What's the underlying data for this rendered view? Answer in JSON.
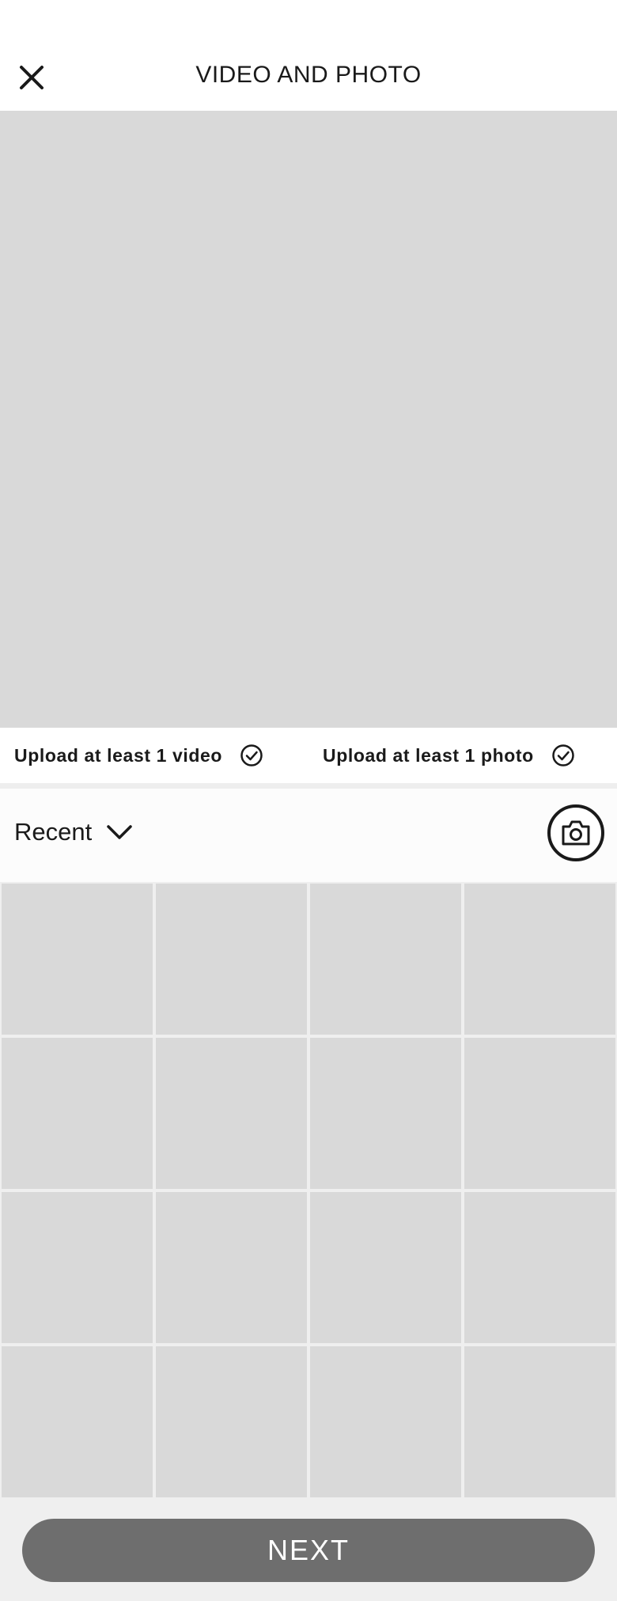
{
  "header": {
    "title": "VIDEO AND PHOTO",
    "close_icon": "close-icon"
  },
  "requirements": {
    "video_label": "Upload at least 1 video",
    "photo_label": "Upload at least 1 photo",
    "check_icon": "check-circle-icon"
  },
  "album": {
    "selected": "Recent",
    "chevron_icon": "chevron-down-icon",
    "camera_icon": "camera-icon"
  },
  "gallery": {
    "columns": 4,
    "rows": 4,
    "thumbnail_color": "#d9d9d9"
  },
  "footer": {
    "next_label": "NEXT"
  },
  "colors": {
    "preview_bg": "#d9d9d9",
    "button_bg": "#6e6e6e",
    "text": "#1a1a1a"
  }
}
